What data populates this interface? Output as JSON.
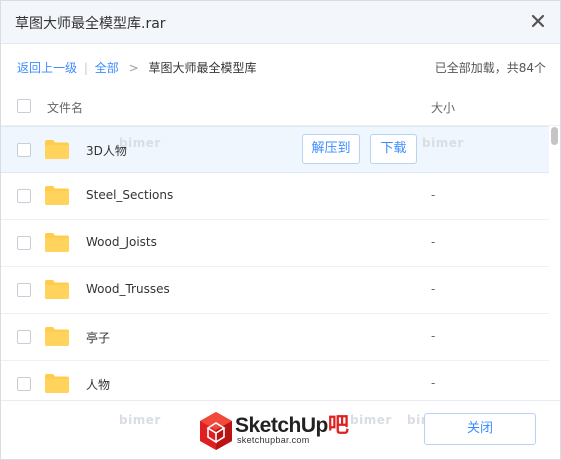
{
  "dialog": {
    "title": "草图大师最全模型库.rar"
  },
  "breadcrumb": {
    "back": "返回上一级",
    "separator": "|",
    "all": "全部",
    "arrow": ">",
    "current": "草图大师最全模型库"
  },
  "status": {
    "loaded": "已全部加载，共84个"
  },
  "table": {
    "col_name": "文件名",
    "col_size": "大小",
    "rows": [
      {
        "name": "3D人物",
        "size": ""
      },
      {
        "name": "Steel_Sections",
        "size": "-"
      },
      {
        "name": "Wood_Joists",
        "size": "-"
      },
      {
        "name": "Wood_Trusses",
        "size": "-"
      },
      {
        "name": "亭子",
        "size": "-"
      },
      {
        "name": "人物",
        "size": "-"
      }
    ]
  },
  "row_actions": {
    "extract": "解压到",
    "download": "下载"
  },
  "footer": {
    "close": "关闭"
  },
  "watermark": {
    "text": "bimer"
  },
  "logo": {
    "brand": "SketchUp",
    "brand_accent": "吧",
    "url": "sketchupbar.com"
  },
  "colors": {
    "accent": "#3b8cff",
    "folder": "#ffcc4d",
    "logo_red": "#e02020"
  }
}
